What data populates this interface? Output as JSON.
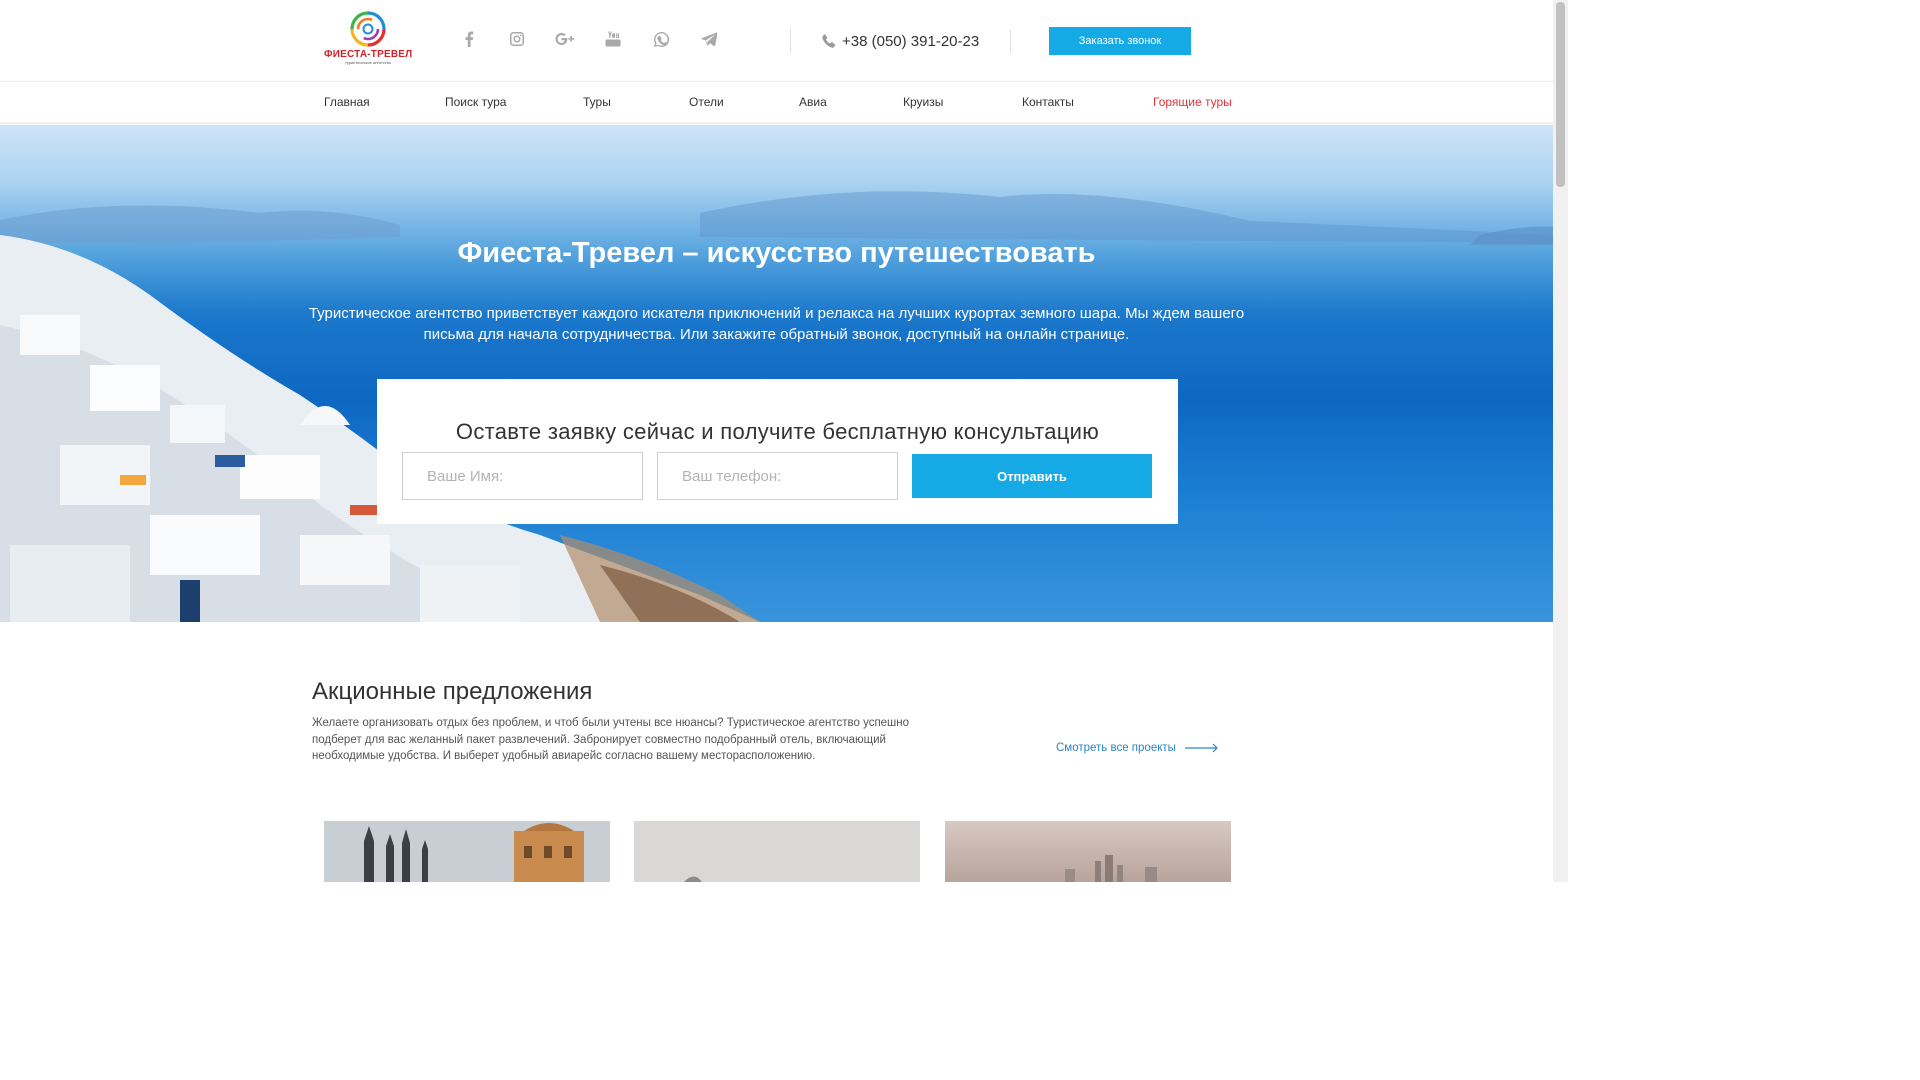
{
  "header": {
    "logo": {
      "name": "ФИЕСТА-ТРЕВЕЛ",
      "subtitle": "туристическое агентство"
    },
    "socials": [
      "facebook-icon",
      "instagram-icon",
      "google-plus-icon",
      "youtube-icon",
      "whatsapp-icon",
      "telegram-icon"
    ],
    "phone": "+38 (050) 391-20-23",
    "callback_label": "Заказать звонок"
  },
  "nav": {
    "items": [
      {
        "label": "Главная"
      },
      {
        "label": "Поиск тура"
      },
      {
        "label": "Туры"
      },
      {
        "label": "Отели"
      },
      {
        "label": "Авиа"
      },
      {
        "label": "Круизы"
      },
      {
        "label": "Контакты"
      },
      {
        "label": "Горящие туры"
      }
    ]
  },
  "hero": {
    "title": "Фиеста-Тревел – искусство путешествовать",
    "text": "Туристическое агентство приветствует каждого искателя приключений и релакса на лучших курортах земного шара. Мы ждем вашего письма для начала сотрудничества. Или закажите обратный звонок, доступный на онлайн странице.",
    "form": {
      "title": "Оставте заявку сейчас и получите бесплатную консультацию",
      "name_placeholder": "Ваше Имя:",
      "phone_placeholder": "Ваш телефон:",
      "submit_label": "Отправить"
    }
  },
  "offers": {
    "title": "Акционные предложения",
    "text": "Желаете организовать отдых без проблем, и чтоб были учтены все нюансы? Туристическое агентство успешно подберет для вас желанный пакет развлечений. Забронирует совместно подобранный отель, включающий необходимые удобства. И выберет удобный авиарейс согласно вашему месторасположению.",
    "all_link": "Смотреть все проекты"
  },
  "colors": {
    "accent": "#15aae6",
    "hot": "#e5333b",
    "link": "#2b84c6"
  }
}
